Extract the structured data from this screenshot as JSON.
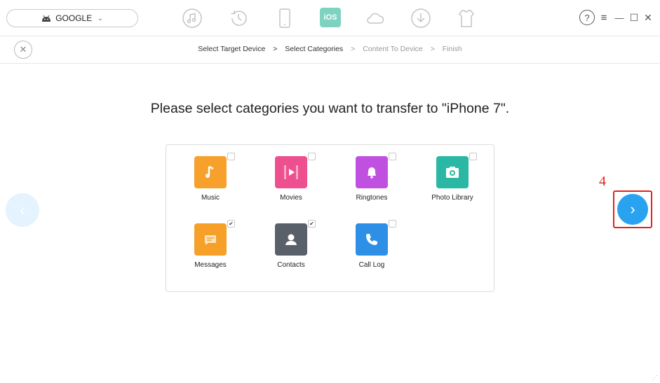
{
  "device": {
    "name": "GOOGLE",
    "icon": "android-icon"
  },
  "toolbar": {
    "tools": [
      "music-note-icon",
      "history-icon",
      "phone-icon",
      "ios-transfer-icon",
      "cloud-icon",
      "download-icon",
      "tshirt-icon"
    ],
    "ios_label": "iOS"
  },
  "window": {
    "help": "?",
    "menu": "≡",
    "minimize": "—",
    "maximize": "☐",
    "close": "✕"
  },
  "breadcrumb": {
    "steps": [
      "Select Target Device",
      "Select Categories",
      "Content To Device",
      "Finish"
    ],
    "separator": ">"
  },
  "main": {
    "title": "Please select categories you want to transfer to \"iPhone 7\".",
    "categories": [
      {
        "label": "Music",
        "icon": "music-icon",
        "color": "#f7a12c",
        "checked": false
      },
      {
        "label": "Movies",
        "icon": "movie-icon",
        "color": "#ee4f8f",
        "checked": false
      },
      {
        "label": "Ringtones",
        "icon": "bell-icon",
        "color": "#c051e0",
        "checked": false
      },
      {
        "label": "Photo Library",
        "icon": "camera-icon",
        "color": "#2ab8a5",
        "checked": false
      },
      {
        "label": "Messages",
        "icon": "message-icon",
        "color": "#f6a029",
        "checked": true
      },
      {
        "label": "Contacts",
        "icon": "contact-icon",
        "color": "#5a6069",
        "checked": true
      },
      {
        "label": "Call Log",
        "icon": "phone-call-icon",
        "color": "#2d8fe5",
        "checked": false
      }
    ]
  },
  "nav": {
    "prev": "‹",
    "next": "›"
  },
  "annotation": {
    "step": "4",
    "color": "#e2231a"
  },
  "accent": "#29a3ef"
}
